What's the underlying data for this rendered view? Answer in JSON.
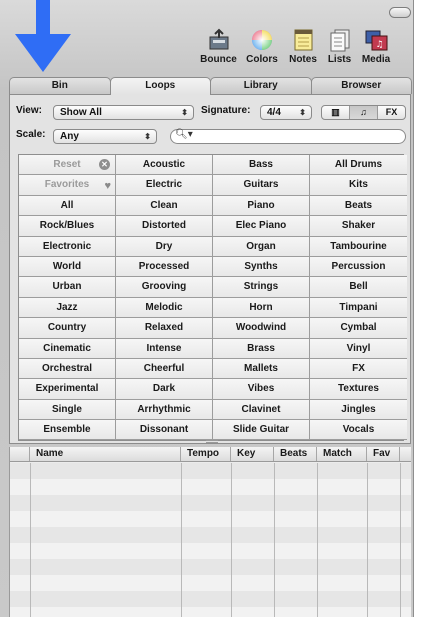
{
  "toolbar": {
    "bounce": "Bounce",
    "colors": "Colors",
    "notes": "Notes",
    "lists": "Lists",
    "media": "Media"
  },
  "tabs": [
    "Bin",
    "Loops",
    "Library",
    "Browser"
  ],
  "active_tab": "Loops",
  "filters": {
    "view_label": "View:",
    "view_value": "Show All",
    "signature_label": "Signature:",
    "signature_value": "4/4",
    "scale_label": "Scale:",
    "scale_value": "Any",
    "search_value": "",
    "view_modes": [
      "▥",
      "♫",
      "FX"
    ]
  },
  "keywords": [
    [
      "Reset",
      "Acoustic",
      "Bass",
      "All Drums"
    ],
    [
      "Favorites",
      "Electric",
      "Guitars",
      "Kits"
    ],
    [
      "All",
      "Clean",
      "Piano",
      "Beats"
    ],
    [
      "Rock/Blues",
      "Distorted",
      "Elec Piano",
      "Shaker"
    ],
    [
      "Electronic",
      "Dry",
      "Organ",
      "Tambourine"
    ],
    [
      "World",
      "Processed",
      "Synths",
      "Percussion"
    ],
    [
      "Urban",
      "Grooving",
      "Strings",
      "Bell"
    ],
    [
      "Jazz",
      "Melodic",
      "Horn",
      "Timpani"
    ],
    [
      "Country",
      "Relaxed",
      "Woodwind",
      "Cymbal"
    ],
    [
      "Cinematic",
      "Intense",
      "Brass",
      "Vinyl"
    ],
    [
      "Orchestral",
      "Cheerful",
      "Mallets",
      "FX"
    ],
    [
      "Experimental",
      "Dark",
      "Vibes",
      "Textures"
    ],
    [
      "Single",
      "Arrhythmic",
      "Clavinet",
      "Jingles"
    ],
    [
      "Ensemble",
      "Dissonant",
      "Slide Guitar",
      "Vocals"
    ]
  ],
  "table": {
    "columns": [
      "Name",
      "Tempo",
      "Key",
      "Beats",
      "Match",
      "Fav"
    ]
  },
  "colors": {
    "arrow": "#2f6df5"
  }
}
